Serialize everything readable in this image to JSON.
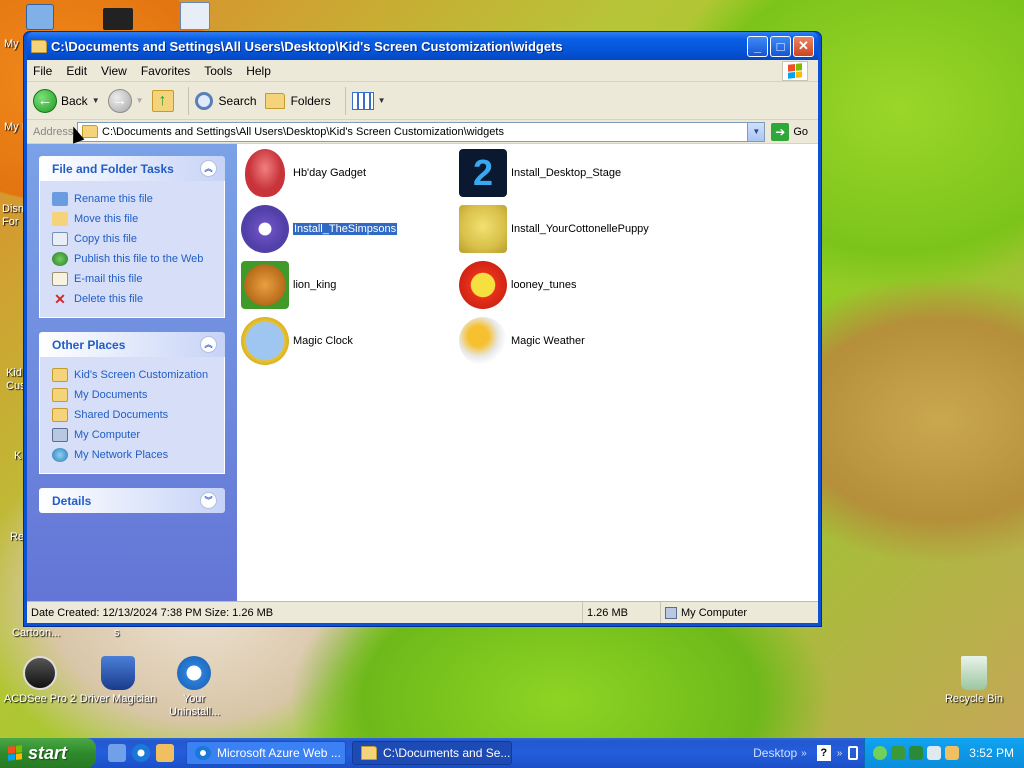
{
  "desktop": {
    "icons": [
      {
        "label": "ACDSee Pro 2"
      },
      {
        "label": "Driver Magician"
      },
      {
        "label": "Your Uninstall..."
      },
      {
        "label": "Recycle Bin"
      }
    ],
    "edge_labels": [
      "My",
      "My I",
      "Disn For",
      "Kid Cus",
      "K",
      "Re",
      "Cartoon...",
      "s"
    ]
  },
  "window": {
    "title": "C:\\Documents and Settings\\All Users\\Desktop\\Kid's Screen Customization\\widgets",
    "controls": {
      "minimize": "_",
      "maximize": "□",
      "close": "✕"
    },
    "menu": [
      "File",
      "Edit",
      "View",
      "Favorites",
      "Tools",
      "Help"
    ],
    "toolbar": {
      "back": "Back",
      "search": "Search",
      "folders": "Folders"
    },
    "address": {
      "label": "Address",
      "value": "C:\\Documents and Settings\\All Users\\Desktop\\Kid's Screen Customization\\widgets",
      "go": "Go"
    },
    "side": {
      "tasks": {
        "title": "File and Folder Tasks",
        "items": [
          "Rename this file",
          "Move this file",
          "Copy this file",
          "Publish this file to the Web",
          "E-mail this file",
          "Delete this file"
        ]
      },
      "places": {
        "title": "Other Places",
        "items": [
          "Kid's Screen Customization",
          "My Documents",
          "Shared Documents",
          "My Computer",
          "My Network Places"
        ]
      },
      "details": {
        "title": "Details"
      }
    },
    "files": [
      {
        "name": "Hb'day Gadget"
      },
      {
        "name": "Install_Desktop_Stage"
      },
      {
        "name": "Install_TheSimpsons"
      },
      {
        "name": "Install_YourCottonellePuppy"
      },
      {
        "name": "lion_king"
      },
      {
        "name": "looney_tunes"
      },
      {
        "name": "Magic Clock"
      },
      {
        "name": "Magic Weather"
      }
    ],
    "status": {
      "info": "Date Created: 12/13/2024 7:38 PM Size: 1.26 MB",
      "size": "1.26 MB",
      "zone": "My Computer"
    }
  },
  "taskbar": {
    "start": "start",
    "tasks": [
      {
        "label": "Microsoft Azure Web ..."
      },
      {
        "label": "C:\\Documents and Se..."
      }
    ],
    "desktop_toolbar": "Desktop",
    "clock": "3:52 PM"
  },
  "colors": {
    "xp_blue": "#0553d6",
    "panel_link": "#215dc6",
    "selection": "#316ac5"
  }
}
